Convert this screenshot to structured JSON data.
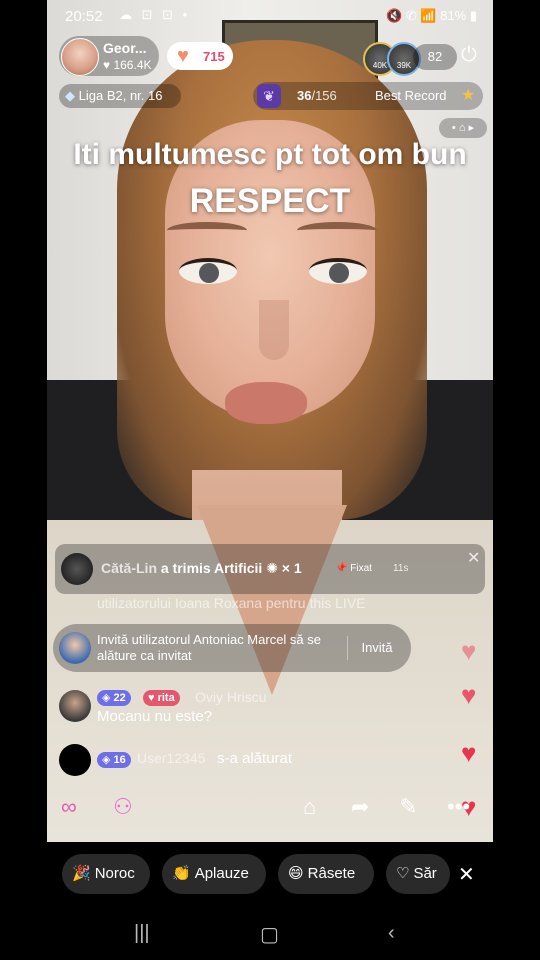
{
  "status_bar": {
    "time": "20:52",
    "left_icons": "☁ ⊡ ⊡ •",
    "right_icons": "🔇 ✆ 📶 81% ▮"
  },
  "host": {
    "name": "Geor...",
    "likes": "♥ 166.4K",
    "follow_count": "715"
  },
  "viewers": {
    "badge_1": "40K",
    "badge_2": "39K",
    "count": "82"
  },
  "league": {
    "label": "Liga B2, nr. 16"
  },
  "goal": {
    "progress": "36",
    "total": "/156",
    "best_record": "Best Record"
  },
  "captions": {
    "line1": "Iti multumesc pt tot om bun",
    "line2": "RESPECT"
  },
  "pinned": {
    "user": "Cătă-Lin",
    "text": " a trimis Artificii",
    "multiplier": " × 1",
    "pin_label": "Fixat",
    "age": "11s"
  },
  "chat": {
    "partial_line": "utilizatorului Ioana Roxana pentru this LIVE",
    "invite_text": "Invită utilizatorul Antoniac Marcel să se alăture ca invitat",
    "invite_button": "Invită",
    "messages": [
      {
        "level": "22",
        "fan_badge": "rita",
        "user": "Oviy Hriscu",
        "text": "Mocanu nu este?"
      },
      {
        "level": "16",
        "user": "User12345",
        "text": " s-a alăturat"
      }
    ]
  },
  "reactions": [
    {
      "icon": "🎉",
      "label": "Noroc"
    },
    {
      "icon": "👏",
      "label": "Aplauze"
    },
    {
      "icon": "😄",
      "label": "Râsete"
    },
    {
      "icon": "♡",
      "label": "Săr"
    }
  ],
  "colors": {
    "heart": "#e8354f",
    "follow_text": "#e84a6b",
    "pill_bg": "#2a2a2a"
  }
}
